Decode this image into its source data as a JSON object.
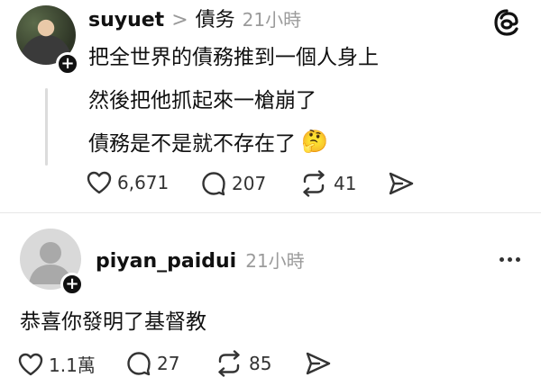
{
  "post": {
    "username": "suyuet",
    "separator": ">",
    "topic": "債务",
    "time": "21小時",
    "lines": [
      "把全世界的債務推到一個人身上",
      "然後把他抓起來一槍崩了",
      "債務是不是就不存在了"
    ],
    "emoji": "🤔",
    "actions": {
      "likes": "6,671",
      "replies": "207",
      "reposts": "41"
    }
  },
  "reply": {
    "username": "piyan_paidui",
    "time": "21小時",
    "text": "恭喜你發明了基督教",
    "actions": {
      "likes": "1.1萬",
      "replies": "27",
      "reposts": "85"
    }
  },
  "badge_symbol": "+",
  "icons": {
    "logo": "threads-logo-icon",
    "like": "heart-icon",
    "reply": "speech-bubble-icon",
    "repost": "repost-icon",
    "share": "send-icon",
    "more": "more-horizontal-icon"
  },
  "colors": {
    "text": "#111111",
    "muted": "#9b9b9b",
    "divider": "#e6e6e6"
  }
}
